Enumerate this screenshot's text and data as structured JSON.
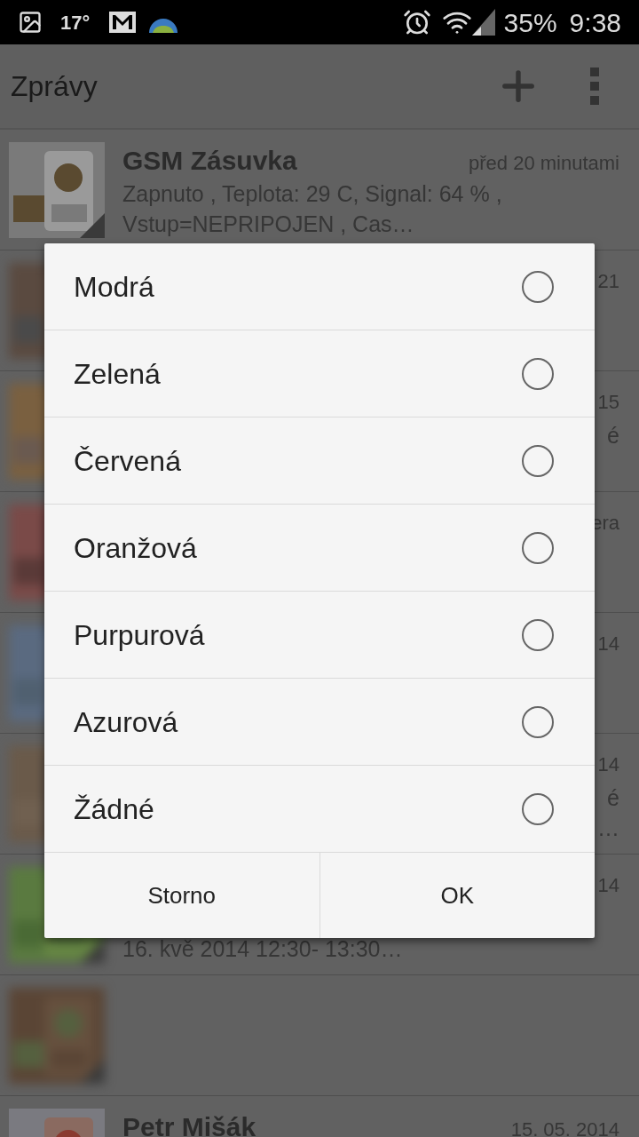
{
  "status_bar": {
    "temperature": "17°",
    "battery": "35%",
    "time": "9:38"
  },
  "app_bar": {
    "title": "Zprávy"
  },
  "messages": [
    {
      "thumbnail": {
        "kind": "picture"
      },
      "title": "GSM Zásuvka",
      "date": "před 20 minutami",
      "lines": [
        "Zapnuto , Teplota: 29 C, Signal: 64 % ,",
        "Vstup=NEPRIPOJEN , Cas…"
      ]
    },
    {
      "thumbnail": {
        "kind": "picture"
      },
      "date": "21"
    },
    {
      "thumbnail": {
        "kind": "picture"
      },
      "date": "15",
      "tail": [
        "é"
      ]
    },
    {
      "thumbnail": {
        "kind": "picture"
      },
      "date": "era"
    },
    {
      "thumbnail": {
        "kind": "picture"
      },
      "date": "14"
    },
    {
      "thumbnail": {
        "kind": "picture"
      },
      "date": "14",
      "tail": [
        "é",
        "…"
      ]
    },
    {
      "thumbnail": {
        "kind": "picture"
      },
      "date": "14",
      "lines": [
        "16. kvě 2014 12:30- 13:30…"
      ]
    },
    {
      "thumbnail": {
        "kind": "picture"
      }
    },
    {
      "thumbnail": {
        "kind": "picture"
      },
      "title": "Petr Mišák",
      "date": "15. 05. 2014"
    }
  ],
  "dialog": {
    "options": [
      {
        "label": "Modrá",
        "selected": false
      },
      {
        "label": "Zelená",
        "selected": false
      },
      {
        "label": "Červená",
        "selected": false
      },
      {
        "label": "Oranžová",
        "selected": false
      },
      {
        "label": "Purpurová",
        "selected": false
      },
      {
        "label": "Azurová",
        "selected": false
      },
      {
        "label": "Žádné",
        "selected": false
      }
    ],
    "buttons": [
      "Storno",
      "OK"
    ]
  }
}
